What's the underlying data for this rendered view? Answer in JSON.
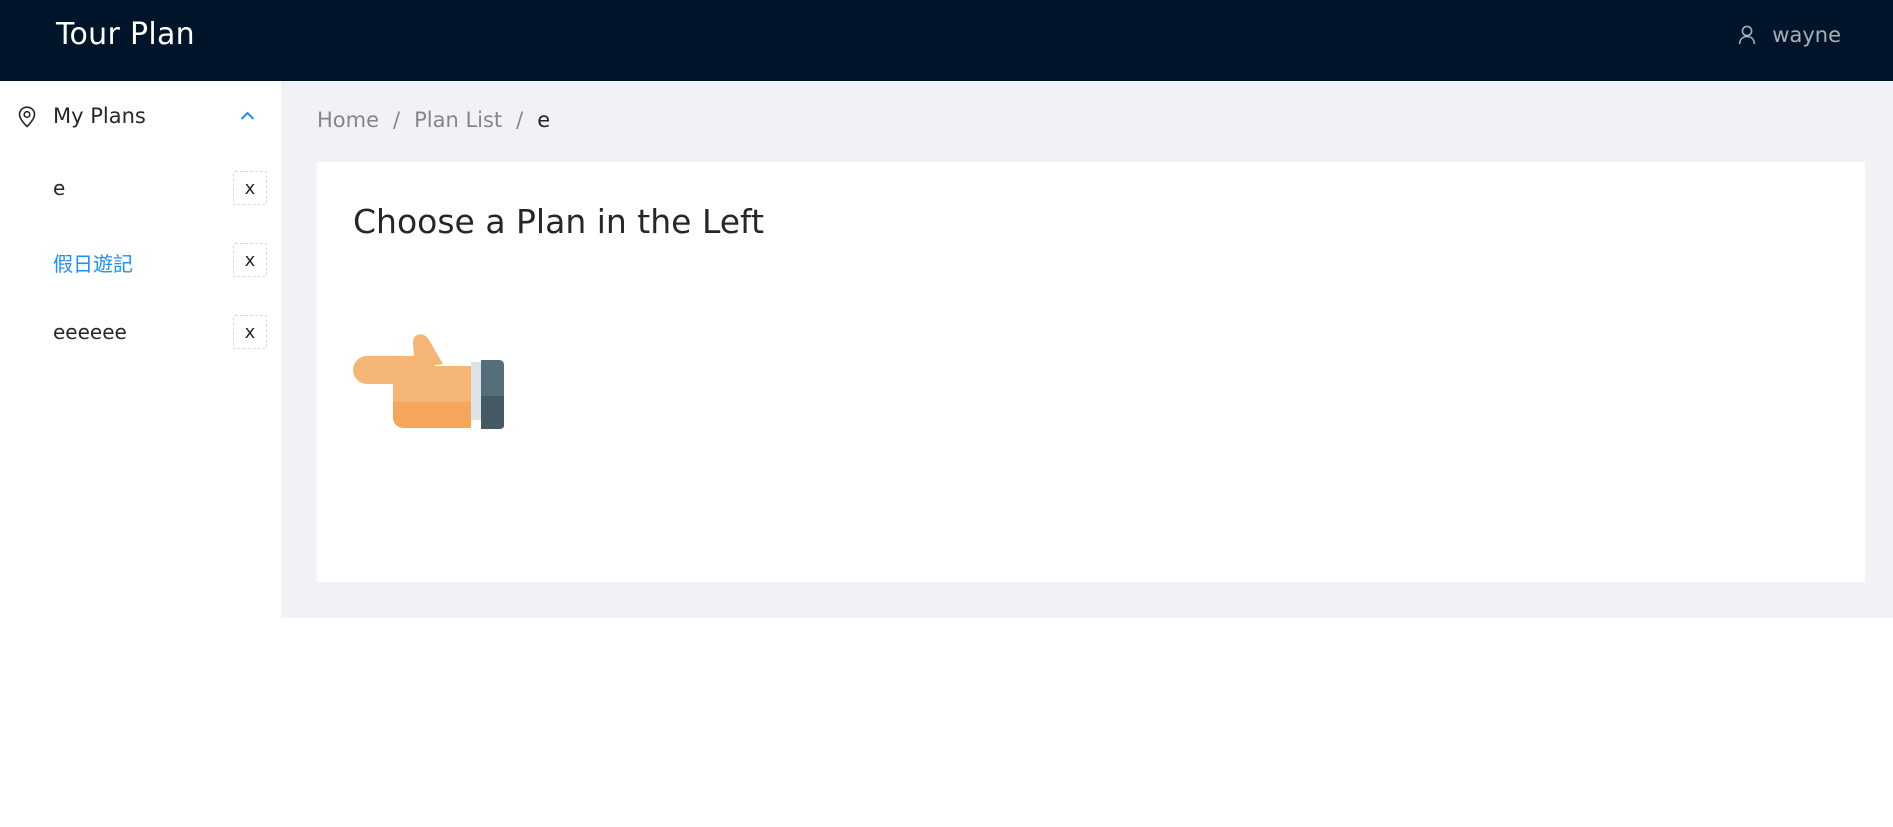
{
  "header": {
    "title": "Tour Plan",
    "user": {
      "icon": "user-icon",
      "name": "wayne"
    }
  },
  "sidebar": {
    "submenu": {
      "icon": "location-pin-icon",
      "label": "My Plans",
      "expanded": true,
      "chevron": "chevron-up-icon"
    },
    "items": [
      {
        "label": "e",
        "delete_label": "x",
        "active": false
      },
      {
        "label": "假日遊記",
        "delete_label": "x",
        "active": true
      },
      {
        "label": "eeeeee",
        "delete_label": "x",
        "active": false
      }
    ]
  },
  "breadcrumb": {
    "items": [
      "Home",
      "Plan List",
      "e"
    ],
    "separator": "/"
  },
  "main": {
    "heading": "Choose a Plan in the Left",
    "illustration": "pointing-hand-left-icon"
  },
  "colors": {
    "header_bg": "#001529",
    "active": "#1890ff",
    "content_bg": "#f0f2f5"
  }
}
